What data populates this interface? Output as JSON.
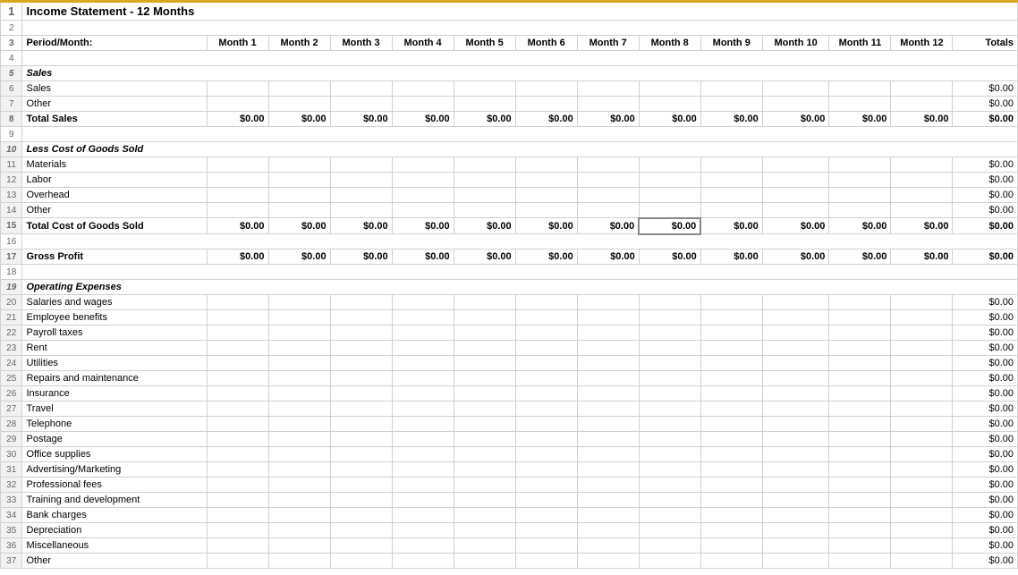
{
  "title": "Income Statement - 12 Months",
  "headers": {
    "row_label": "Period/Month:",
    "months": [
      "Month 1",
      "Month 2",
      "Month 3",
      "Month 4",
      "Month 5",
      "Month 6",
      "Month 7",
      "Month 8",
      "Month 9",
      "Month 10",
      "Month 11",
      "Month 12"
    ],
    "totals": "Totals"
  },
  "zero": "$0.00",
  "rows": [
    {
      "num": 1,
      "type": "title",
      "label": "Income Statement - 12 Months"
    },
    {
      "num": 2,
      "type": "empty"
    },
    {
      "num": 3,
      "type": "header"
    },
    {
      "num": 4,
      "type": "empty"
    },
    {
      "num": 5,
      "type": "section",
      "label": "Sales"
    },
    {
      "num": 6,
      "type": "item",
      "label": "Sales",
      "totals": true
    },
    {
      "num": 7,
      "type": "item",
      "label": "Other",
      "totals": true
    },
    {
      "num": 8,
      "type": "total",
      "label": "Total Sales"
    },
    {
      "num": 9,
      "type": "empty"
    },
    {
      "num": 10,
      "type": "section",
      "label": "Less Cost of Goods Sold"
    },
    {
      "num": 11,
      "type": "item",
      "label": "Materials",
      "totals": true
    },
    {
      "num": 12,
      "type": "item",
      "label": "Labor",
      "totals": true
    },
    {
      "num": 13,
      "type": "item",
      "label": "Overhead",
      "totals": true
    },
    {
      "num": 14,
      "type": "item",
      "label": "Other",
      "totals": true
    },
    {
      "num": 15,
      "type": "total",
      "label": "Total Cost of Goods Sold",
      "highlight": 7
    },
    {
      "num": 16,
      "type": "empty"
    },
    {
      "num": 17,
      "type": "total",
      "label": "Gross Profit"
    },
    {
      "num": 18,
      "type": "empty"
    },
    {
      "num": 19,
      "type": "section",
      "label": "Operating Expenses"
    },
    {
      "num": 20,
      "type": "item",
      "label": "Salaries and wages",
      "totals": true
    },
    {
      "num": 21,
      "type": "item",
      "label": "Employee benefits",
      "totals": true
    },
    {
      "num": 22,
      "type": "item",
      "label": "Payroll taxes",
      "totals": true
    },
    {
      "num": 23,
      "type": "item",
      "label": "Rent",
      "totals": true
    },
    {
      "num": 24,
      "type": "item",
      "label": "Utilities",
      "totals": true
    },
    {
      "num": 25,
      "type": "item",
      "label": "Repairs and maintenance",
      "totals": true
    },
    {
      "num": 26,
      "type": "item",
      "label": "Insurance",
      "totals": true
    },
    {
      "num": 27,
      "type": "item",
      "label": "Travel",
      "totals": true
    },
    {
      "num": 28,
      "type": "item",
      "label": "Telephone",
      "totals": true
    },
    {
      "num": 29,
      "type": "item",
      "label": "Postage",
      "totals": true
    },
    {
      "num": 30,
      "type": "item",
      "label": "Office supplies",
      "totals": true
    },
    {
      "num": 31,
      "type": "item",
      "label": "Advertising/Marketing",
      "totals": true
    },
    {
      "num": 32,
      "type": "item",
      "label": "Professional fees",
      "totals": true
    },
    {
      "num": 33,
      "type": "item",
      "label": "Training and development",
      "totals": true
    },
    {
      "num": 34,
      "type": "item",
      "label": "Bank charges",
      "totals": true
    },
    {
      "num": 35,
      "type": "item",
      "label": "Depreciation",
      "totals": true
    },
    {
      "num": 36,
      "type": "item",
      "label": "Miscellaneous",
      "totals": true
    },
    {
      "num": 37,
      "type": "item",
      "label": "Other",
      "totals": true
    }
  ]
}
